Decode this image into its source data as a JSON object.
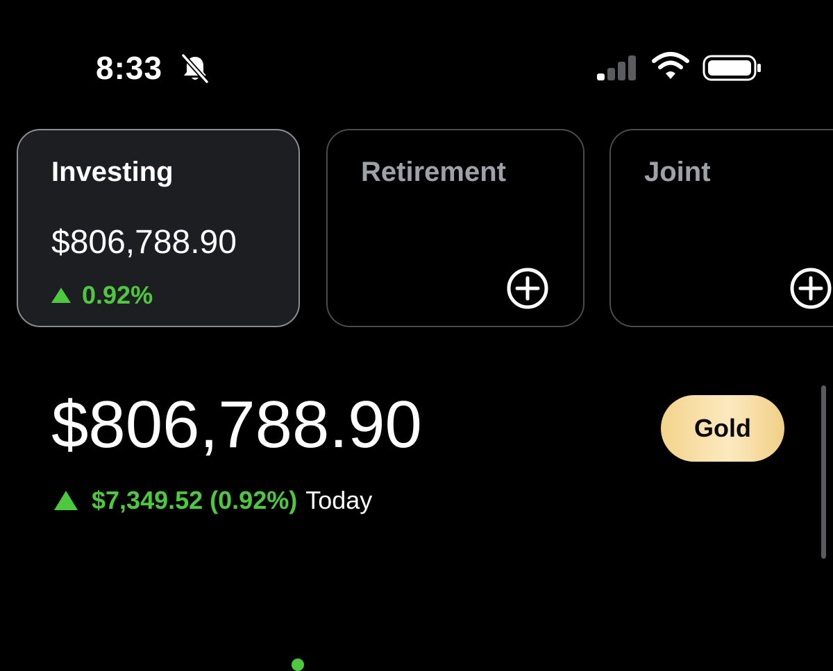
{
  "status_bar": {
    "time": "8:33",
    "icons": [
      "bell-slash-icon",
      "signal-icon",
      "wifi-icon",
      "battery-icon"
    ]
  },
  "accounts": [
    {
      "title": "Investing",
      "value": "$806,788.90",
      "change": "0.92%",
      "selected": true
    },
    {
      "title": "Retirement",
      "action_icon": "plus-circle-icon"
    },
    {
      "title": "Joint",
      "action_icon": "plus-circle-icon"
    }
  ],
  "portfolio": {
    "balance": "$806,788.90",
    "today_change": "$7,349.52 (0.92%)",
    "today_label": "Today",
    "badge": "Gold"
  },
  "colors": {
    "background": "#000000",
    "positive": "#4ec93f",
    "selected_card": "#1d1e21",
    "gold": "#f4d48c"
  }
}
